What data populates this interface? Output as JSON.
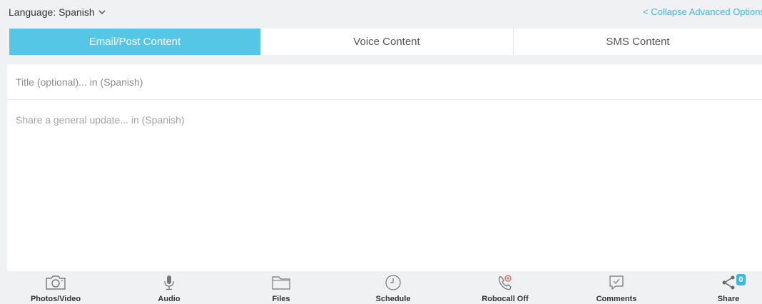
{
  "header": {
    "language_label": "Language: Spanish",
    "collapse_link": "< Collapse Advanced Options"
  },
  "tabs": [
    {
      "label": "Email/Post Content",
      "active": true
    },
    {
      "label": "Voice Content",
      "active": false
    },
    {
      "label": "SMS Content",
      "active": false
    }
  ],
  "editor": {
    "title_placeholder": "Title (optional)... in (Spanish)",
    "body_placeholder": "Share a general update... in (Spanish)"
  },
  "toolbar": {
    "items": [
      {
        "label": "Photos/Video",
        "icon": "camera-icon"
      },
      {
        "label": "Audio",
        "icon": "microphone-icon"
      },
      {
        "label": "Files",
        "icon": "folder-icon"
      },
      {
        "label": "Schedule",
        "icon": "clock-icon"
      },
      {
        "label": "Robocall Off",
        "icon": "phone-off-icon"
      },
      {
        "label": "Comments",
        "icon": "comment-icon"
      },
      {
        "label": "Share",
        "icon": "share-icon",
        "badge": "0"
      }
    ]
  },
  "colors": {
    "accent": "#56c6e6",
    "link": "#3bb8e0",
    "background": "#f0f1f3",
    "robocall_icon": "#e05a5a"
  }
}
